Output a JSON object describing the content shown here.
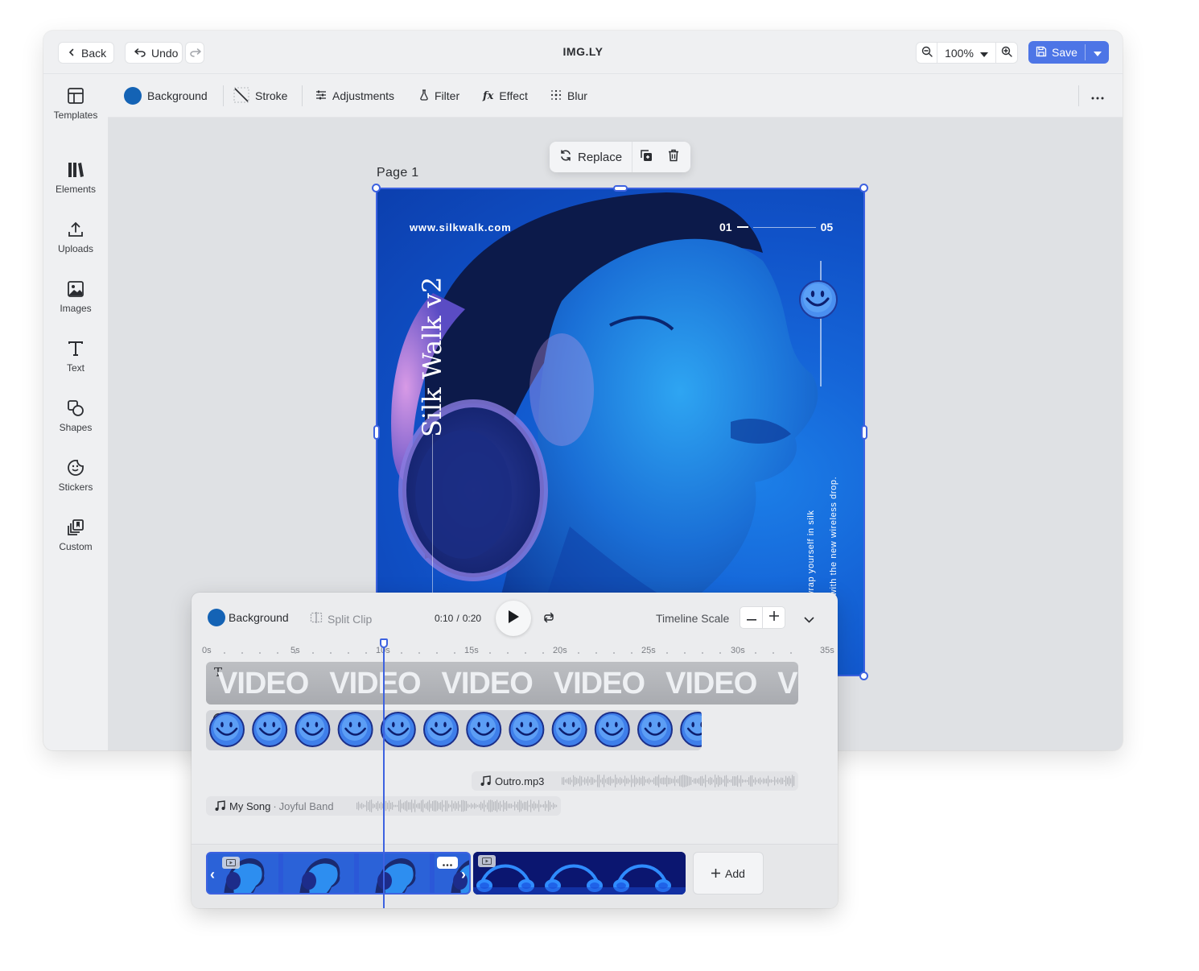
{
  "topbar": {
    "back_label": "Back",
    "undo_label": "Undo",
    "title": "IMG.LY",
    "zoom_value": "100%",
    "save_label": "Save"
  },
  "sidebar": {
    "items": [
      {
        "label": "Templates",
        "icon": "templates-icon"
      },
      {
        "label": "Elements",
        "icon": "elements-icon"
      },
      {
        "label": "Uploads",
        "icon": "upload-icon"
      },
      {
        "label": "Images",
        "icon": "image-icon"
      },
      {
        "label": "Text",
        "icon": "text-icon"
      },
      {
        "label": "Shapes",
        "icon": "shapes-icon"
      },
      {
        "label": "Stickers",
        "icon": "sticker-icon"
      },
      {
        "label": "Custom",
        "icon": "custom-icon"
      }
    ]
  },
  "toolbar": {
    "background_label": "Background",
    "stroke_label": "Stroke",
    "adjustments_label": "Adjustments",
    "filter_label": "Filter",
    "effect_label": "Effect",
    "blur_label": "Blur",
    "background_color": "#1463b5"
  },
  "canvas": {
    "page_label": "Page 1",
    "replace_label": "Replace"
  },
  "artwork": {
    "url": "www.silkwalk.com",
    "counter_start": "01",
    "counter_end": "05",
    "headline": "Silk Walk v2",
    "tagline_1": "wrap yourself in silk",
    "tagline_2": "with the new wireless drop."
  },
  "timeline": {
    "background_label": "Background",
    "split_clip_label": "Split Clip",
    "time_current": "0:10",
    "time_separator": "/",
    "time_total": "0:20",
    "scale_label": "Timeline Scale",
    "ruler_ticks": [
      "0s",
      "5s",
      "10s",
      "15s",
      "20s",
      "25s",
      "30s",
      "35s"
    ],
    "text_track_word": "VIDEO",
    "text_track_tail": "VIDE",
    "audio_1_label": "Outro.mp3",
    "audio_2_title": "My Song",
    "audio_2_sep": "·",
    "audio_2_artist": "Joyful Band",
    "add_label": "Add",
    "playhead_seconds": 10
  },
  "colors": {
    "accent": "#3d62e0",
    "save": "#4d75e6",
    "artwork_blue": "#1565d8"
  }
}
